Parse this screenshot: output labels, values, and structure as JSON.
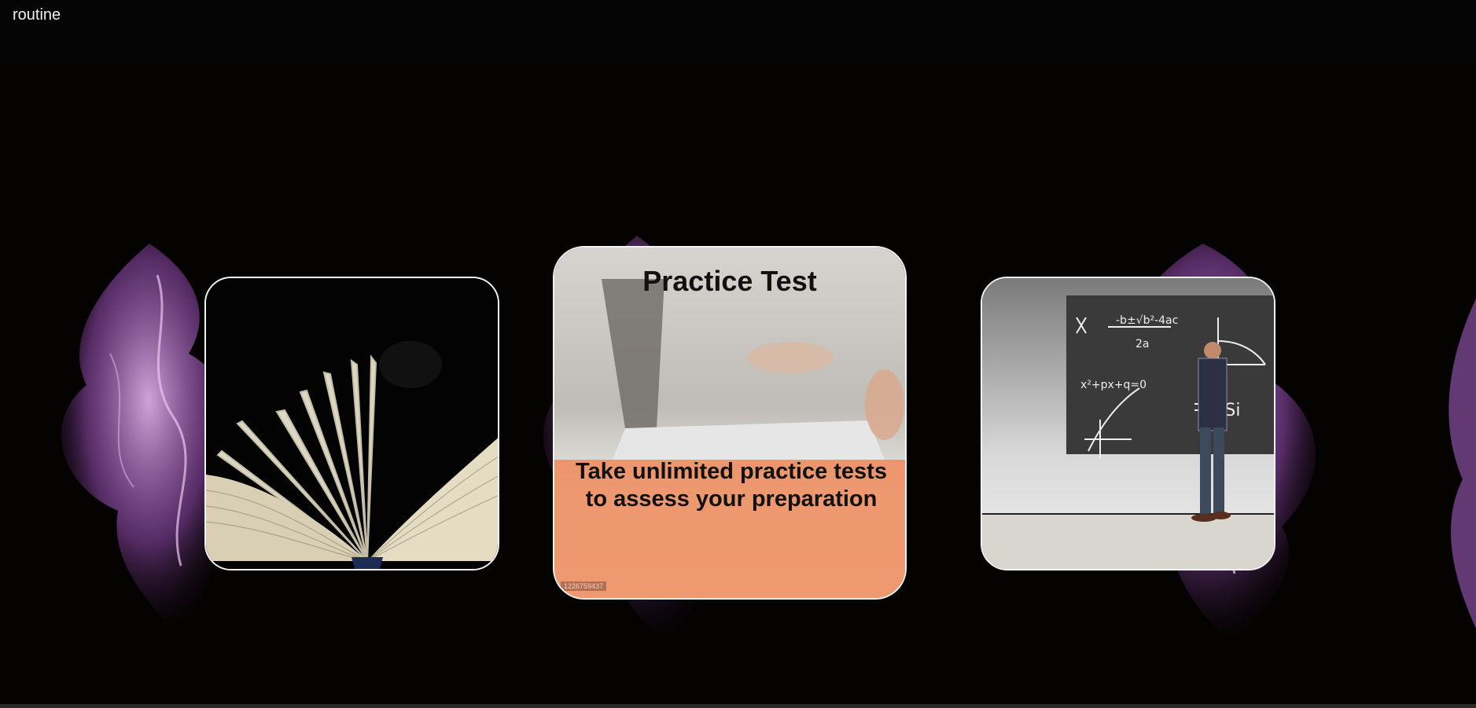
{
  "header": {
    "brand": "routine"
  },
  "cards": {
    "left": {
      "image": "open-book-photo"
    },
    "middle": {
      "image": "laptop-typing-photo",
      "title": "Practice Test",
      "description_line1": "Take unlimited practice tests",
      "description_line2": "to assess your preparation",
      "stock_id": "1226759437"
    },
    "right": {
      "image": "blackboard-math-photo"
    }
  },
  "colors": {
    "background": "#050402",
    "card_border": "#f2f2f2",
    "accent_band": "#ee8c5f",
    "smoke": "#b06bd0"
  }
}
